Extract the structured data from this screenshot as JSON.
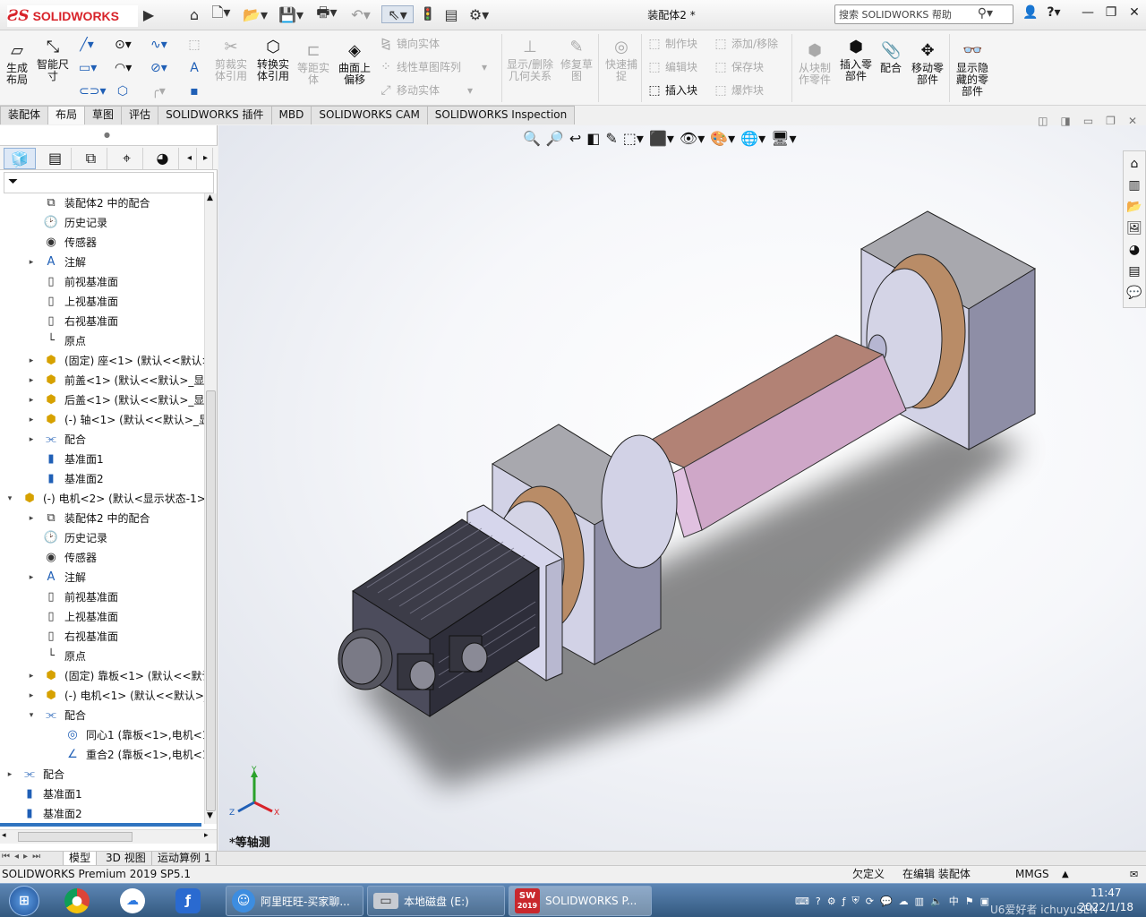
{
  "window": {
    "title": "装配体2 *"
  },
  "brand": {
    "logo_text": "SOLIDWORKS",
    "accent": "#d8232a"
  },
  "search": {
    "placeholder": "搜索 SOLIDWORKS 帮助"
  },
  "toolbar": {
    "big": [
      {
        "label": "生成布局",
        "icon": "layout-icon",
        "enabled": true
      },
      {
        "label": "智能尺寸",
        "icon": "smart-dimension-icon",
        "enabled": true
      },
      {
        "label": "剪裁实体引用",
        "icon": "trim-icon",
        "enabled": false
      },
      {
        "label": "转换实体引用",
        "icon": "convert-entities-icon",
        "enabled": true
      },
      {
        "label": "等距实体",
        "icon": "offset-icon",
        "enabled": false
      },
      {
        "label": "曲面上偏移",
        "icon": "surface-offset-icon",
        "enabled": true
      },
      {
        "label": "显示/删除几何关系",
        "icon": "relations-icon",
        "enabled": false
      },
      {
        "label": "修复草图",
        "icon": "repair-sketch-icon",
        "enabled": false
      },
      {
        "label": "快速捕捉",
        "icon": "quick-snap-icon",
        "enabled": false
      },
      {
        "label": "从块制作零件",
        "icon": "block-part-icon",
        "enabled": false
      },
      {
        "label": "插入零部件",
        "icon": "insert-component-icon",
        "enabled": true
      },
      {
        "label": "配合",
        "icon": "mate-icon",
        "enabled": true
      },
      {
        "label": "移动零部件",
        "icon": "move-component-icon",
        "enabled": true
      },
      {
        "label": "显示隐藏的零部件",
        "icon": "show-hidden-icon",
        "enabled": true
      }
    ],
    "small": [
      {
        "label": "镜向实体",
        "enabled": false
      },
      {
        "label": "线性草图阵列",
        "enabled": false
      },
      {
        "label": "移动实体",
        "enabled": false
      },
      {
        "label": "制作块",
        "enabled": false
      },
      {
        "label": "编辑块",
        "enabled": false
      },
      {
        "label": "插入块",
        "enabled": true
      },
      {
        "label": "添加/移除",
        "enabled": false
      },
      {
        "label": "保存块",
        "enabled": false
      },
      {
        "label": "爆炸块",
        "enabled": false
      }
    ]
  },
  "tabs": [
    "装配体",
    "布局",
    "草图",
    "评估",
    "SOLIDWORKS 插件",
    "MBD",
    "SOLIDWORKS CAM",
    "SOLIDWORKS Inspection"
  ],
  "active_tab": "布局",
  "tree": [
    {
      "label": "装配体2 中的配合",
      "icon": "mates-folder-icon",
      "level": 1,
      "toggle": ""
    },
    {
      "label": "历史记录",
      "icon": "history-icon",
      "level": 1,
      "toggle": ""
    },
    {
      "label": "传感器",
      "icon": "sensor-icon",
      "level": 1,
      "toggle": ""
    },
    {
      "label": "注解",
      "icon": "annotation-icon",
      "level": 1,
      "toggle": "▸"
    },
    {
      "label": "前视基准面",
      "icon": "plane-icon",
      "level": 1,
      "toggle": ""
    },
    {
      "label": "上视基准面",
      "icon": "plane-icon",
      "level": 1,
      "toggle": ""
    },
    {
      "label": "右视基准面",
      "icon": "plane-icon",
      "level": 1,
      "toggle": ""
    },
    {
      "label": "原点",
      "icon": "origin-icon",
      "level": 1,
      "toggle": ""
    },
    {
      "label": "(固定) 座<1> (默认<<默认>",
      "icon": "part-icon",
      "level": 1,
      "toggle": "▸"
    },
    {
      "label": "前盖<1> (默认<<默认>_显示",
      "icon": "part-icon",
      "level": 1,
      "toggle": "▸"
    },
    {
      "label": "后盖<1> (默认<<默认>_显示",
      "icon": "part-icon",
      "level": 1,
      "toggle": "▸"
    },
    {
      "label": "(-) 轴<1> (默认<<默认>_显",
      "icon": "part-icon",
      "level": 1,
      "toggle": "▸"
    },
    {
      "label": "配合",
      "icon": "mate-icon",
      "level": 1,
      "toggle": "▸"
    },
    {
      "label": "基准面1",
      "icon": "datum-plane-icon",
      "level": 1,
      "toggle": ""
    },
    {
      "label": "基准面2",
      "icon": "datum-plane-icon",
      "level": 1,
      "toggle": ""
    },
    {
      "label": "(-) 电机<2> (默认<显示状态-1>",
      "icon": "subassembly-icon",
      "level": 0,
      "toggle": "▾"
    },
    {
      "label": "装配体2 中的配合",
      "icon": "mates-folder-icon",
      "level": 1,
      "toggle": "▸"
    },
    {
      "label": "历史记录",
      "icon": "history-icon",
      "level": 1,
      "toggle": ""
    },
    {
      "label": "传感器",
      "icon": "sensor-icon",
      "level": 1,
      "toggle": ""
    },
    {
      "label": "注解",
      "icon": "annotation-icon",
      "level": 1,
      "toggle": "▸"
    },
    {
      "label": "前视基准面",
      "icon": "plane-icon",
      "level": 1,
      "toggle": ""
    },
    {
      "label": "上视基准面",
      "icon": "plane-icon",
      "level": 1,
      "toggle": ""
    },
    {
      "label": "右视基准面",
      "icon": "plane-icon",
      "level": 1,
      "toggle": ""
    },
    {
      "label": "原点",
      "icon": "origin-icon",
      "level": 1,
      "toggle": ""
    },
    {
      "label": "(固定) 靠板<1> (默认<<默认",
      "icon": "part-icon",
      "level": 1,
      "toggle": "▸"
    },
    {
      "label": "(-) 电机<1> (默认<<默认>_",
      "icon": "part-icon",
      "level": 1,
      "toggle": "▸"
    },
    {
      "label": "配合",
      "icon": "mate-icon",
      "level": 1,
      "toggle": "▾"
    },
    {
      "label": "同心1 (靠板<1>,电机<1",
      "icon": "concentric-icon",
      "level": 2,
      "toggle": ""
    },
    {
      "label": "重合2 (靠板<1>,电机<1",
      "icon": "coincident-icon",
      "level": 2,
      "toggle": ""
    },
    {
      "label": "配合",
      "icon": "mate-icon",
      "level": 0,
      "toggle": "▸"
    },
    {
      "label": "基准面1",
      "icon": "datum-plane-icon",
      "level": 0,
      "toggle": ""
    },
    {
      "label": "基准面2",
      "icon": "datum-plane-icon",
      "level": 0,
      "toggle": ""
    }
  ],
  "viewport": {
    "view_name": "*等轴测"
  },
  "model_tabs": [
    "模型",
    "3D 视图",
    "运动算例 1"
  ],
  "status": {
    "product": "SOLIDWORKS Premium 2019 SP5.1",
    "constraint": "欠定义",
    "mode": "在编辑 装配体",
    "units": "MMGS"
  },
  "taskbar": {
    "items": [
      {
        "label": "阿里旺旺-买家聊...",
        "icon": "aliwangwang-icon"
      },
      {
        "label": "本地磁盘 (E:)",
        "icon": "drive-icon"
      },
      {
        "label": "SOLIDWORKS P...",
        "icon": "solidworks-icon"
      }
    ],
    "time": "11:47",
    "date": "2022/1/18",
    "watermark": "U6爱好者 ichuyuSEN",
    "solidworks_badge": "2019"
  }
}
